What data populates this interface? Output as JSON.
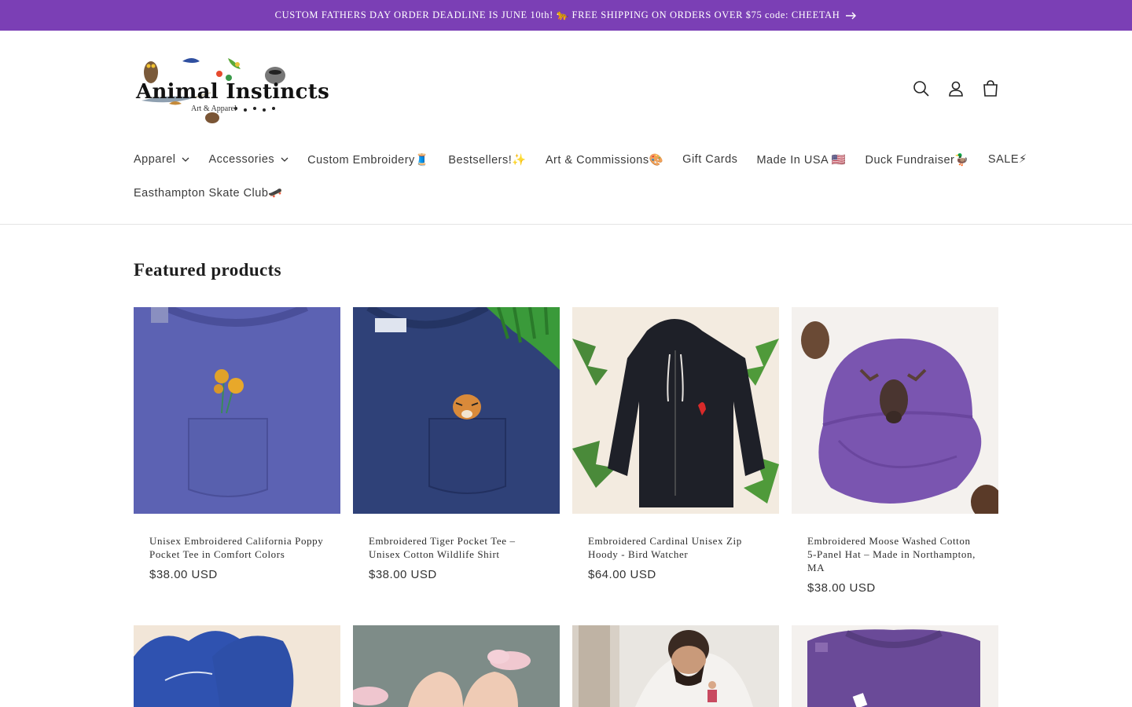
{
  "announcement": {
    "text": "CUSTOM FATHERS DAY ORDER DEADLINE IS JUNE 10th! 🐆 FREE SHIPPING ON ORDERS OVER $75 code: CHEETAH"
  },
  "header": {
    "logo_title": "Animal Instincts",
    "logo_subtitle": "Art & Apparel",
    "icons": [
      "search-icon",
      "account-icon",
      "cart-icon"
    ]
  },
  "nav": {
    "items": [
      {
        "label": "Apparel",
        "dropdown": true
      },
      {
        "label": "Accessories",
        "dropdown": true
      },
      {
        "label": "Custom Embroidery🧵",
        "dropdown": false
      },
      {
        "label": "Bestsellers!✨",
        "dropdown": false
      },
      {
        "label": "Art & Commissions🎨",
        "dropdown": false
      },
      {
        "label": "Gift Cards",
        "dropdown": false
      },
      {
        "label": "Made In USA 🇺🇸",
        "dropdown": false
      },
      {
        "label": "Duck Fundraiser🦆",
        "dropdown": false
      },
      {
        "label": "SALE⚡",
        "dropdown": false
      },
      {
        "label": "Easthampton Skate Club🛹",
        "dropdown": false
      }
    ]
  },
  "featured": {
    "title": "Featured products",
    "products": [
      {
        "title": "Unisex Embroidered California Poppy Pocket Tee in Comfort Colors",
        "price": "$38.00 USD"
      },
      {
        "title": "Embroidered Tiger Pocket Tee – Unisex Cotton Wildlife Shirt",
        "price": "$38.00 USD"
      },
      {
        "title": "Embroidered Cardinal Unisex Zip Hoody - Bird Watcher",
        "price": "$64.00 USD"
      },
      {
        "title": "Embroidered Moose Washed Cotton 5-Panel Hat – Made in Northampton, MA",
        "price": "$38.00 USD"
      }
    ]
  },
  "colors": {
    "announcement_bg": "#7b3fb5",
    "text": "#2b2b2b"
  }
}
